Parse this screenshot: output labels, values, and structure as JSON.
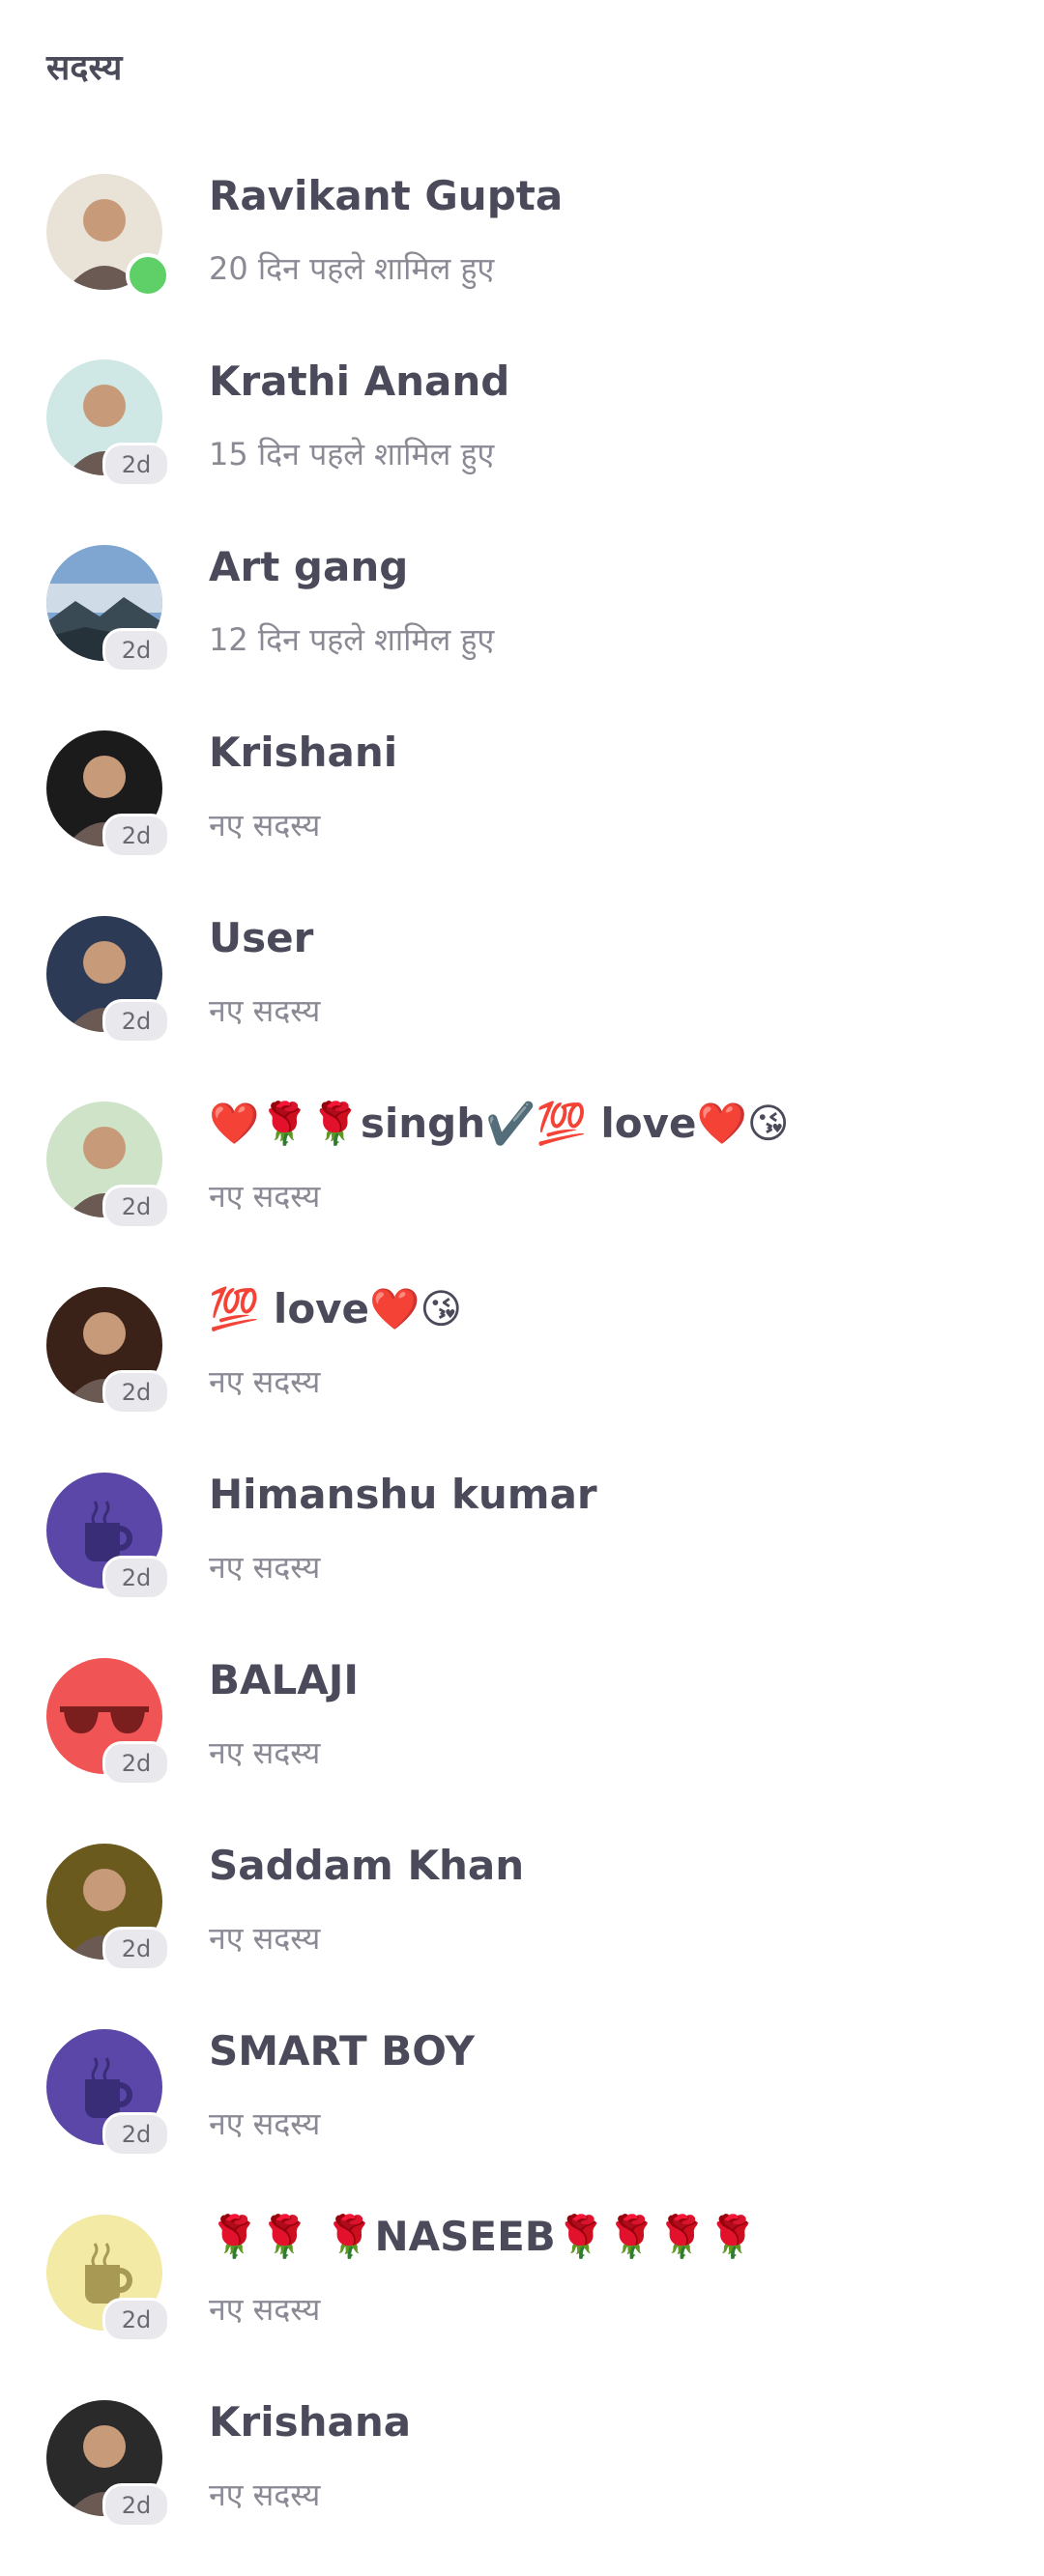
{
  "header": {
    "title": "सदस्य"
  },
  "members": [
    {
      "name": "Ravikant Gupta",
      "subtitle": "20 दिन पहले शामिल हुए",
      "badge": "",
      "online": true,
      "avatar": "photo-man",
      "bg": "#e9e2d6"
    },
    {
      "name": "Krathi Anand",
      "subtitle": " 15 दिन पहले शामिल हुए",
      "badge": "2d",
      "online": false,
      "avatar": "photo-person-teal",
      "bg": "#cfe8e6"
    },
    {
      "name": "Art gang",
      "subtitle": " 12 दिन पहले शामिल हुए",
      "badge": "2d",
      "online": false,
      "avatar": "photo-landscape",
      "bg": "#6a8fb8"
    },
    {
      "name": "Krishani",
      "subtitle": "नए सदस्य",
      "badge": "2d",
      "online": false,
      "avatar": "photo-woman-dark",
      "bg": "#1b1b1b"
    },
    {
      "name": "User",
      "subtitle": "नए सदस्य",
      "badge": "2d",
      "online": false,
      "avatar": "photo-woman-blur",
      "bg": "#2c3a55"
    },
    {
      "name": "❤️🌹🌹singh✔️💯 love❤️😘",
      "subtitle": "नए सदस्य",
      "badge": "2d",
      "online": false,
      "avatar": "photo-woman-hand",
      "bg": "#cfe3c9"
    },
    {
      "name": "💯 love❤️😘",
      "subtitle": "नए सदस्य",
      "badge": "2d",
      "online": false,
      "avatar": "photo-woman-portrait",
      "bg": "#3b2218"
    },
    {
      "name": "Himanshu kumar",
      "subtitle": "नए सदस्य",
      "badge": "2d",
      "online": false,
      "avatar": "cup-icon",
      "bg": "#5b47a8"
    },
    {
      "name": "BALAJI",
      "subtitle": "नए सदस्य",
      "badge": "2d",
      "online": false,
      "avatar": "sunglasses-icon",
      "bg": "#f05454"
    },
    {
      "name": "Saddam Khan",
      "subtitle": "नए सदस्य",
      "badge": "2d",
      "online": false,
      "avatar": "photo-child",
      "bg": "#6b5a1e"
    },
    {
      "name": "SMART BOY",
      "subtitle": "नए सदस्य",
      "badge": "2d",
      "online": false,
      "avatar": "cup-icon",
      "bg": "#5b47a8"
    },
    {
      "name": "🌹🌹 🌹NASEEB🌹🌹🌹🌹",
      "subtitle": "नए सदस्य",
      "badge": "2d",
      "online": false,
      "avatar": "cup-icon-light",
      "bg": "#f2eaa5"
    },
    {
      "name": "Krishana",
      "subtitle": "नए सदस्य",
      "badge": "2d",
      "online": false,
      "avatar": "photo-woman-earrings",
      "bg": "#2a2a2a"
    }
  ]
}
